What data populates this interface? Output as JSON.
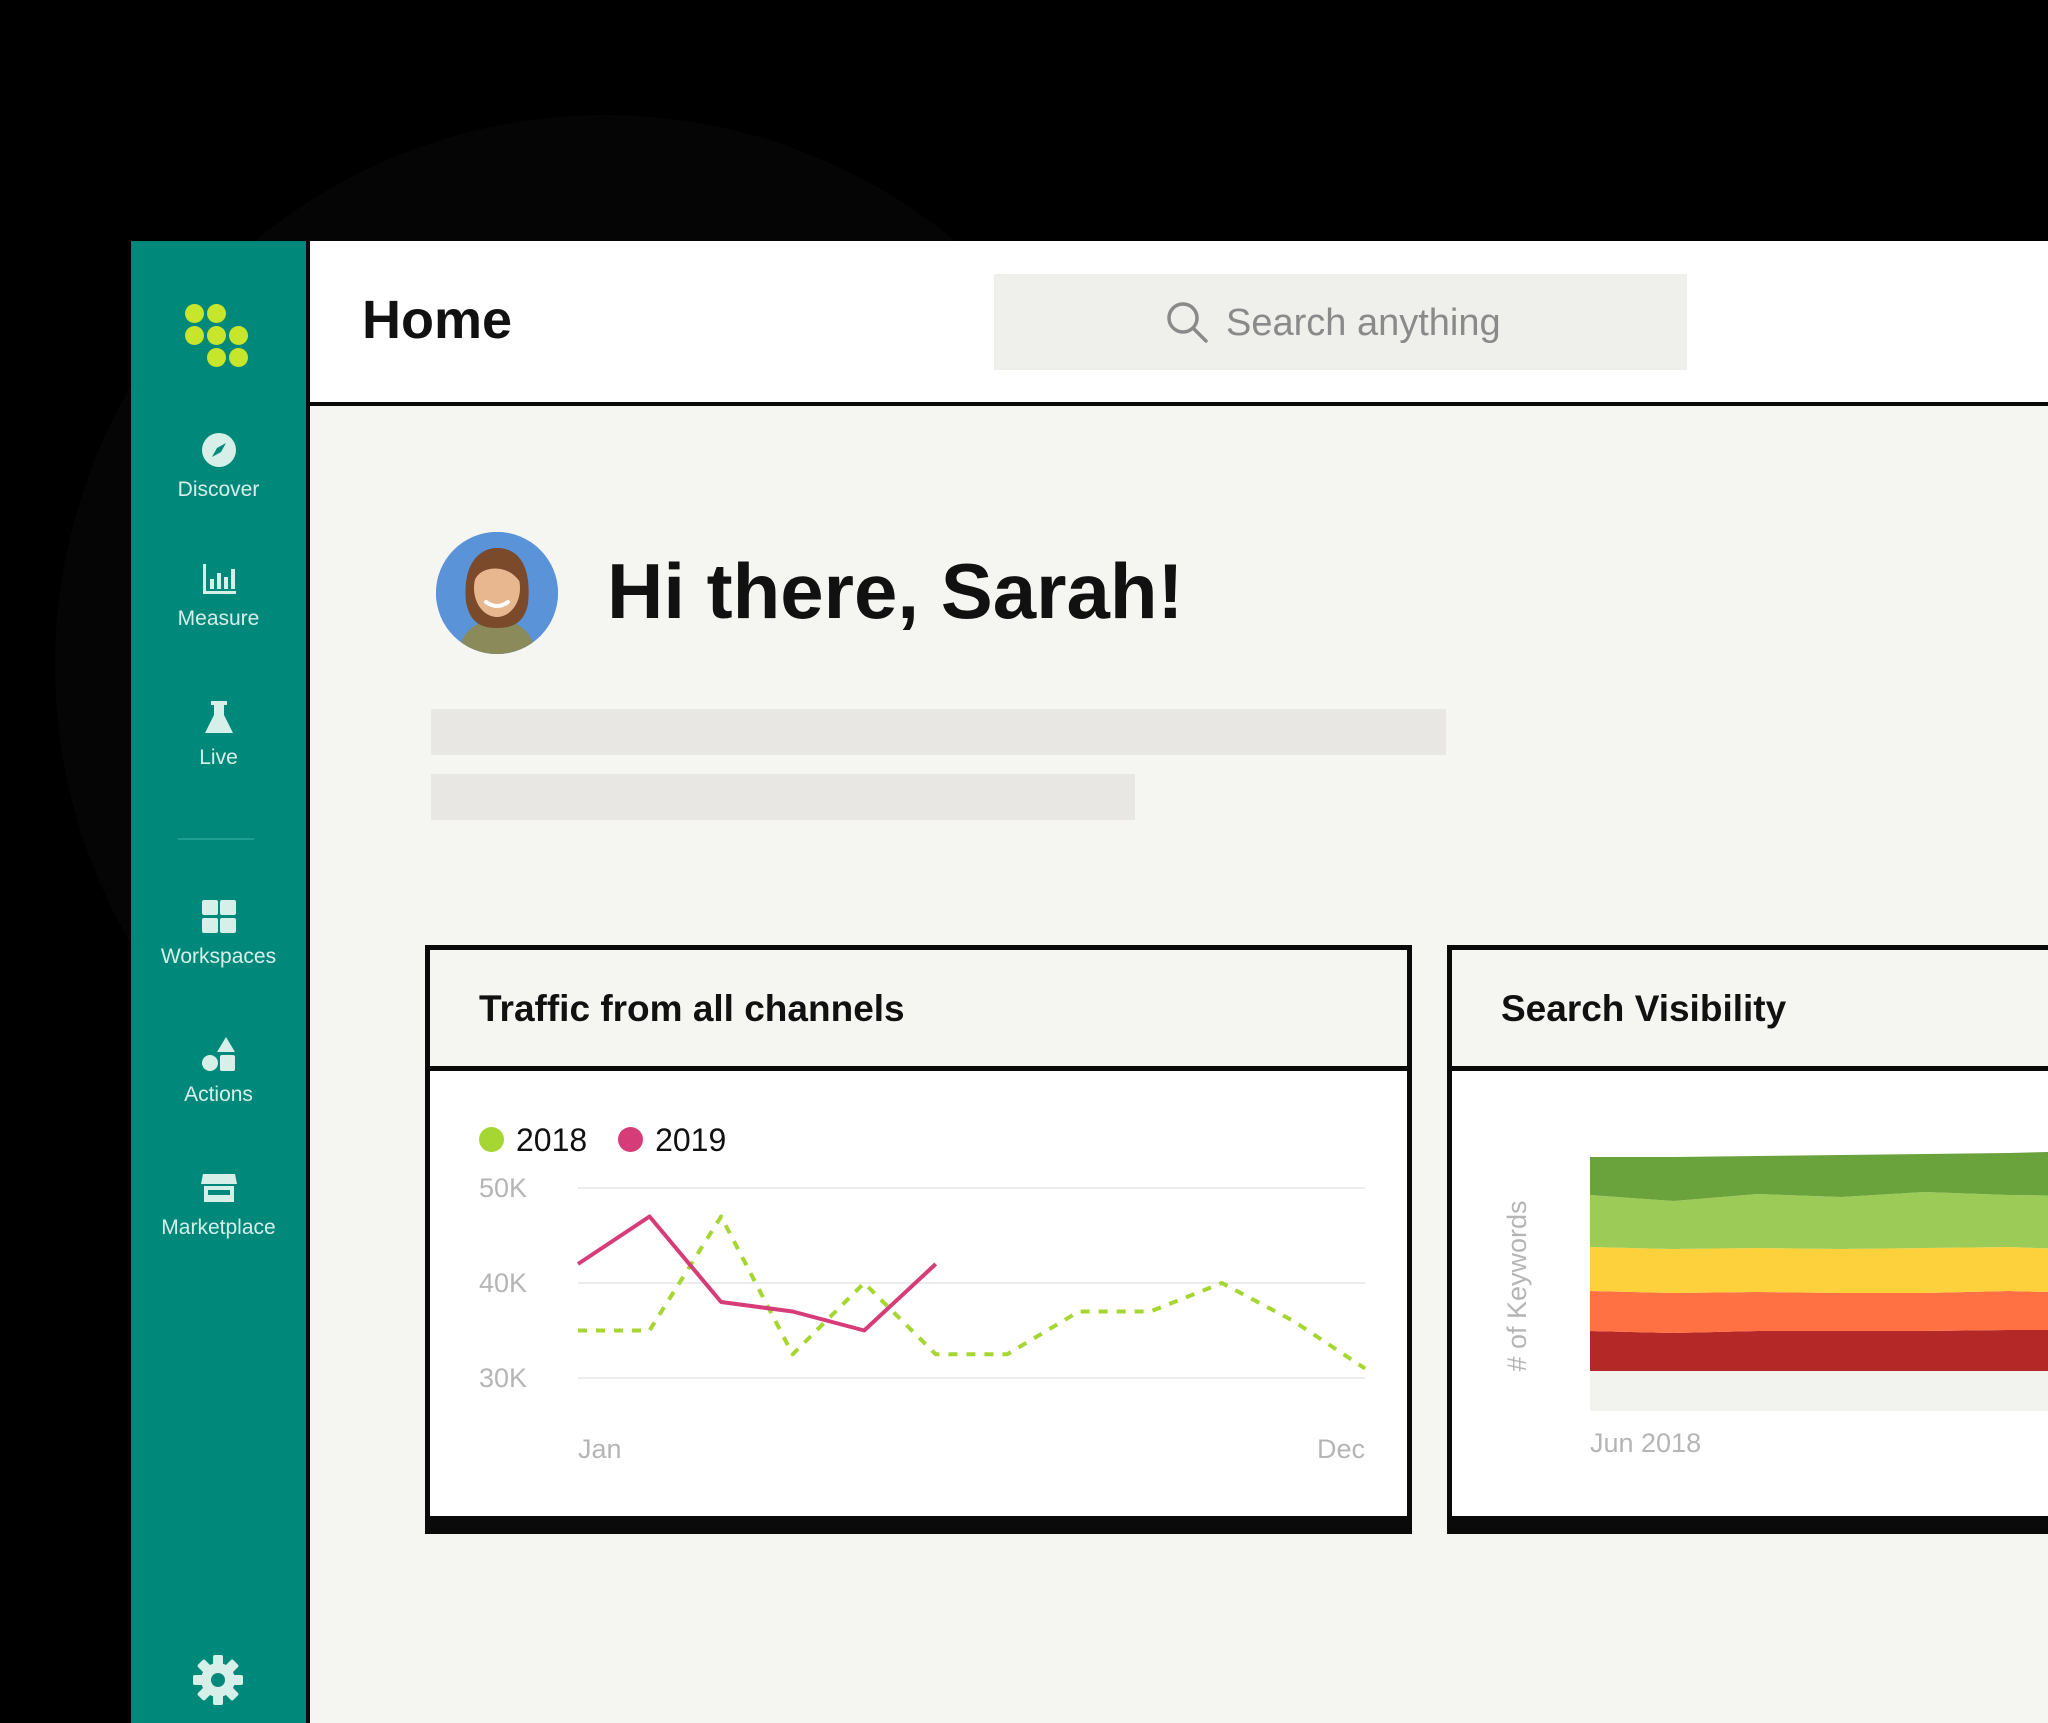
{
  "sidebar": {
    "items": [
      {
        "label": "Discover",
        "icon": "compass-icon"
      },
      {
        "label": "Measure",
        "icon": "bar-chart-icon"
      },
      {
        "label": "Live",
        "icon": "flask-icon"
      },
      {
        "label": "Workspaces",
        "icon": "grid-icon"
      },
      {
        "label": "Actions",
        "icon": "shapes-icon"
      },
      {
        "label": "Marketplace",
        "icon": "store-icon"
      }
    ],
    "settings_icon": "gear-icon",
    "logo_icon": "dots-logo-icon",
    "colors": {
      "background": "#00897b",
      "logo": "#c7e52b"
    }
  },
  "header": {
    "title": "Home",
    "search_placeholder": "Search anything"
  },
  "greeting": "Hi there, Sarah!",
  "cards": {
    "traffic": {
      "title": "Traffic from all channels"
    },
    "visibility": {
      "title": "Search Visibility"
    }
  },
  "chart_data": [
    {
      "type": "line",
      "title": "Traffic from all channels",
      "legend_placement": "top-left",
      "x_tick_labels": [
        "Jan",
        "Dec"
      ],
      "y_tick_labels": [
        "50K",
        "40K",
        "30K"
      ],
      "ylim": [
        30000,
        50000
      ],
      "grid": true,
      "series": [
        {
          "name": "2018",
          "color": "#a5d631",
          "style": "dashed",
          "values": [
            35000,
            35000,
            47000,
            32500,
            40000,
            32500,
            32500,
            37000,
            37000,
            40000,
            36000,
            31000
          ]
        },
        {
          "name": "2019",
          "color": "#d63c78",
          "style": "solid",
          "values": [
            42000,
            47000,
            38000,
            37000,
            35000,
            42000
          ]
        }
      ]
    },
    {
      "type": "area",
      "title": "Search Visibility",
      "ylabel": "# of Keywords",
      "x_tick_labels": [
        "Jun 2018"
      ],
      "colors": [
        "#b52828",
        "#ff7043",
        "#fdd13c",
        "#9ccc57",
        "#6aa23c"
      ],
      "layers": [
        [
          40,
          38,
          40,
          40,
          40,
          41,
          41
        ],
        [
          40,
          40,
          39,
          38,
          38,
          39,
          37
        ],
        [
          44,
          44,
          44,
          44,
          45,
          44,
          43
        ],
        [
          52,
          48,
          54,
          52,
          56,
          52,
          54
        ],
        [
          38,
          44,
          38,
          42,
          38,
          42,
          45
        ]
      ]
    }
  ]
}
